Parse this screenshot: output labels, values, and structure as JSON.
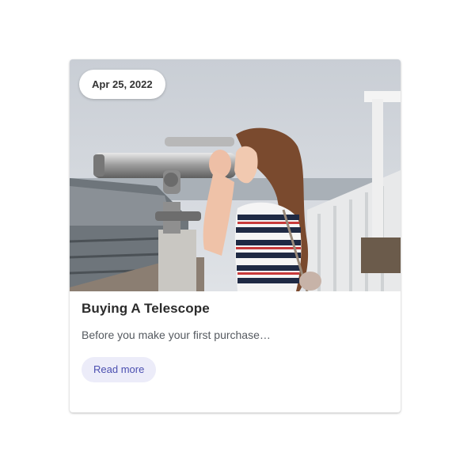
{
  "card": {
    "date": "Apr 25, 2022",
    "title": "Buying A Telescope",
    "excerpt": "Before you make your first purchase…",
    "read_more_label": "Read more"
  },
  "colors": {
    "accent": "#4b4fb0",
    "accent_bg": "#ececf9",
    "title_text": "#2b2b2b",
    "body_text": "#555a60"
  }
}
